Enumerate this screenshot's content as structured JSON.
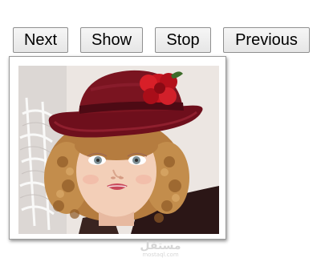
{
  "controls": {
    "next_label": "Next",
    "show_label": "Show",
    "stop_label": "Stop",
    "previous_label": "Previous"
  },
  "slideshow": {
    "image_alt": "Child wearing a red hat with a red flower"
  },
  "watermark": {
    "main": "مستقل",
    "sub": "mostaql.com"
  },
  "colors": {
    "hat": "#7a1420",
    "flower": "#c8141f",
    "hair": "#c08a4a",
    "skin": "#f3cfb8",
    "background": "#ece6e2"
  }
}
